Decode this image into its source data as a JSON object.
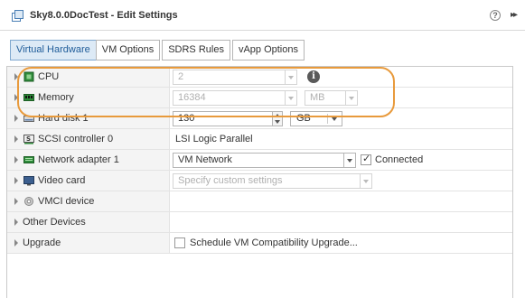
{
  "window": {
    "title": "Sky8.0.0DocTest - Edit Settings",
    "help_glyph": "?",
    "more_glyph": "▸▸"
  },
  "tabs": [
    {
      "label": "Virtual Hardware",
      "active": true
    },
    {
      "label": "VM Options",
      "active": false
    },
    {
      "label": "SDRS Rules",
      "active": false
    },
    {
      "label": "vApp Options",
      "active": false
    }
  ],
  "rows": {
    "cpu": {
      "label": "CPU",
      "value": "2",
      "info_glyph": "i"
    },
    "memory": {
      "label": "Memory",
      "value": "16384",
      "unit": "MB"
    },
    "hard_disk": {
      "label": "Hard disk 1",
      "value": "130",
      "unit": "GB"
    },
    "scsi": {
      "label": "SCSI controller 0",
      "value": "LSI Logic Parallel"
    },
    "network": {
      "label": "Network adapter 1",
      "value": "VM Network",
      "connected_label": "Connected",
      "connected": true
    },
    "video": {
      "label": "Video card",
      "placeholder": "Specify custom settings"
    },
    "vmci": {
      "label": "VMCI device"
    },
    "other": {
      "label": "Other Devices"
    },
    "upgrade": {
      "label": "Upgrade",
      "checkbox_label": "Schedule VM Compatibility Upgrade...",
      "checked": false
    }
  },
  "colors": {
    "active_tab_bg": "#ddeaf6",
    "highlight_outline": "#e89a3c"
  }
}
